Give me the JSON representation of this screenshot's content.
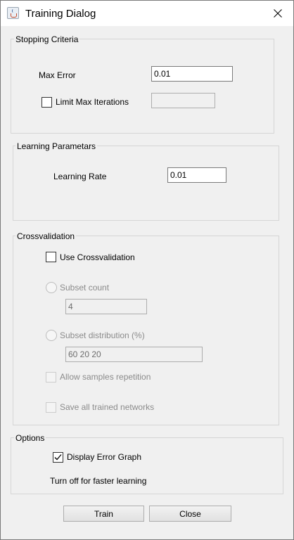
{
  "window": {
    "title": "Training Dialog",
    "close_glyph": "✕"
  },
  "stopping_criteria": {
    "legend": "Stopping Criteria",
    "max_error_label": "Max Error",
    "max_error_value": "0.01",
    "limit_iterations_label": "Limit Max Iterations",
    "limit_iterations_checked": false,
    "max_iterations_value": ""
  },
  "learning_parameters": {
    "legend": "Learning Parametars",
    "learning_rate_label": "Learning Rate",
    "learning_rate_value": "0.01"
  },
  "crossvalidation": {
    "legend": "Crossvalidation",
    "use_label": "Use Crossvalidation",
    "use_checked": false,
    "subset_count_label": "Subset count",
    "subset_count_value": "4",
    "subset_distribution_label": "Subset distribution (%)",
    "subset_distribution_value": "60 20 20",
    "allow_repetition_label": "Allow samples repetition",
    "save_networks_label": "Save all trained networks"
  },
  "options": {
    "legend": "Options",
    "display_graph_label": "Display Error Graph",
    "display_graph_checked": true,
    "hint": "Turn off for faster learning"
  },
  "buttons": {
    "train": "Train",
    "close": "Close"
  },
  "icons": {
    "app": "java-cup-icon",
    "close": "close-icon",
    "check": "checkmark-icon"
  }
}
